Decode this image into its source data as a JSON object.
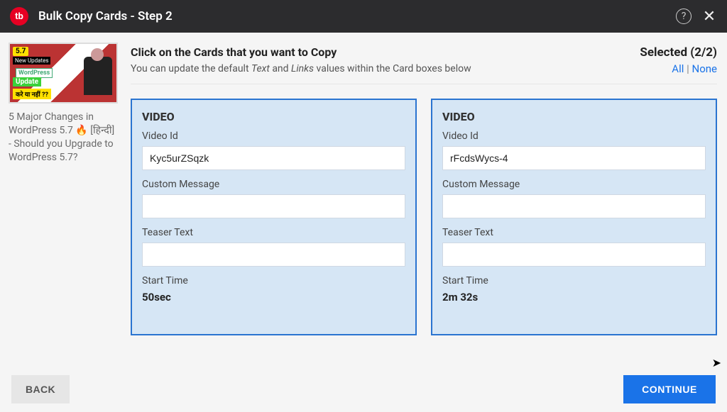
{
  "header": {
    "logo_text": "tb",
    "title": "Bulk Copy Cards - Step 2"
  },
  "sidebar": {
    "thumb": {
      "badge": "5.7",
      "new_line": "New Updates",
      "wp": "WordPress",
      "update": "Update",
      "bottom": "करे या नहीं ??"
    },
    "video_title": "5 Major Changes in WordPress 5.7 🔥 [हिन्दी] - Should you Upgrade to WordPress 5.7?"
  },
  "instruct": {
    "title": "Click on the Cards that you want to Copy",
    "sub_pre": "You can update the default ",
    "sub_text": "Text",
    "sub_and": " and ",
    "sub_links": "Links",
    "sub_post": " values within the Card boxes below"
  },
  "selection": {
    "label": "Selected (2/2)",
    "all": "All",
    "sep": " | ",
    "none": "None"
  },
  "labels": {
    "video_id": "Video Id",
    "custom_message": "Custom Message",
    "teaser_text": "Teaser Text",
    "start_time": "Start Time"
  },
  "cards": [
    {
      "type": "VIDEO",
      "video_id": "Kyc5urZSqzk",
      "custom_message": "",
      "teaser_text": "",
      "start_time": "50sec"
    },
    {
      "type": "VIDEO",
      "video_id": "rFcdsWycs-4",
      "custom_message": "",
      "teaser_text": "",
      "start_time": "2m 32s"
    }
  ],
  "footer": {
    "back": "BACK",
    "continue": "CONTINUE"
  }
}
